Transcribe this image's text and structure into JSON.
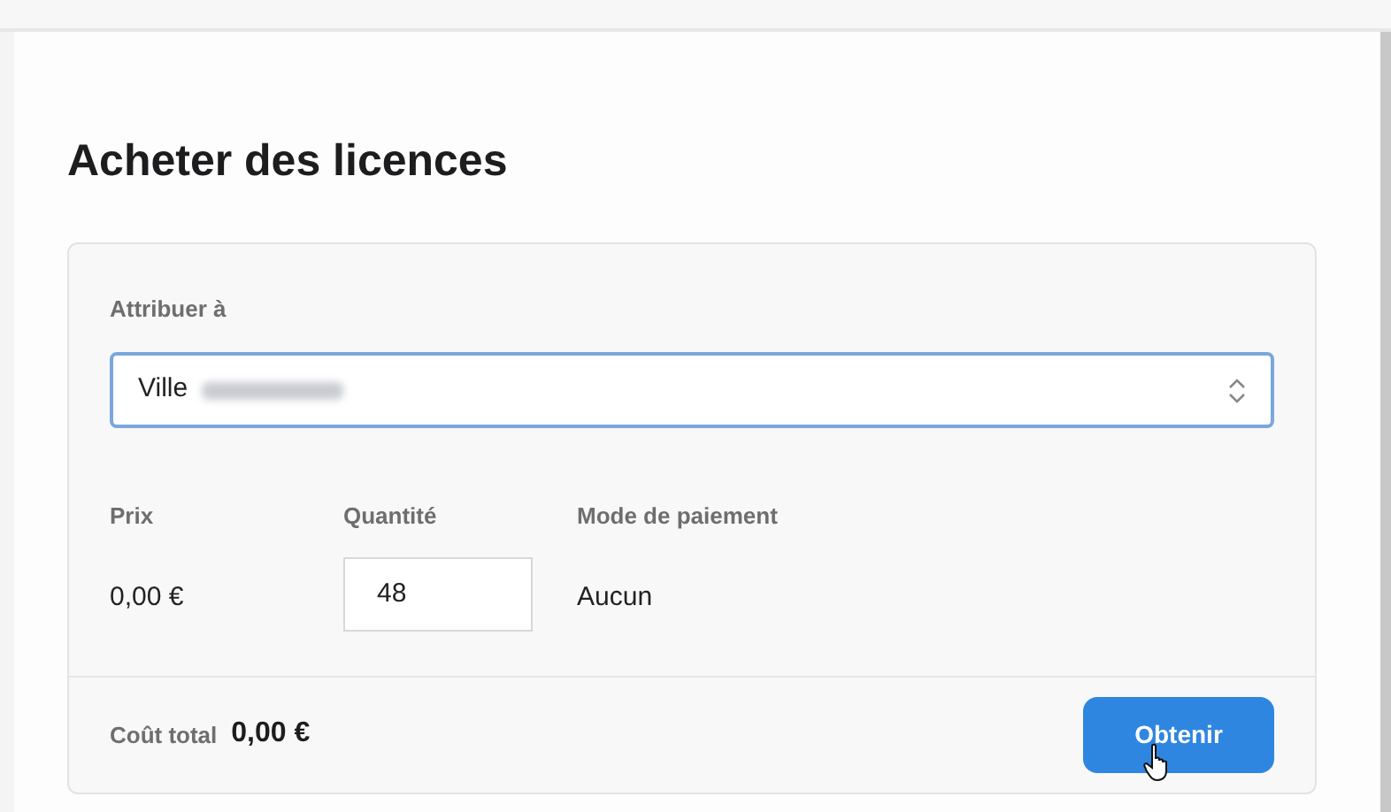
{
  "title": "Acheter des licences",
  "assign": {
    "label": "Attribuer à",
    "value": "Ville",
    "redacted": true
  },
  "columns": [
    {
      "kind": "text",
      "label": "Prix",
      "value": "0,00 €"
    },
    {
      "kind": "input",
      "label": "Quantité",
      "value": "48"
    },
    {
      "kind": "text",
      "label": "Mode de paiement",
      "value": "Aucun"
    }
  ],
  "footer": {
    "label": "Coût total",
    "total": "0,00 €",
    "button": "Obtenir",
    "cursor": true
  }
}
